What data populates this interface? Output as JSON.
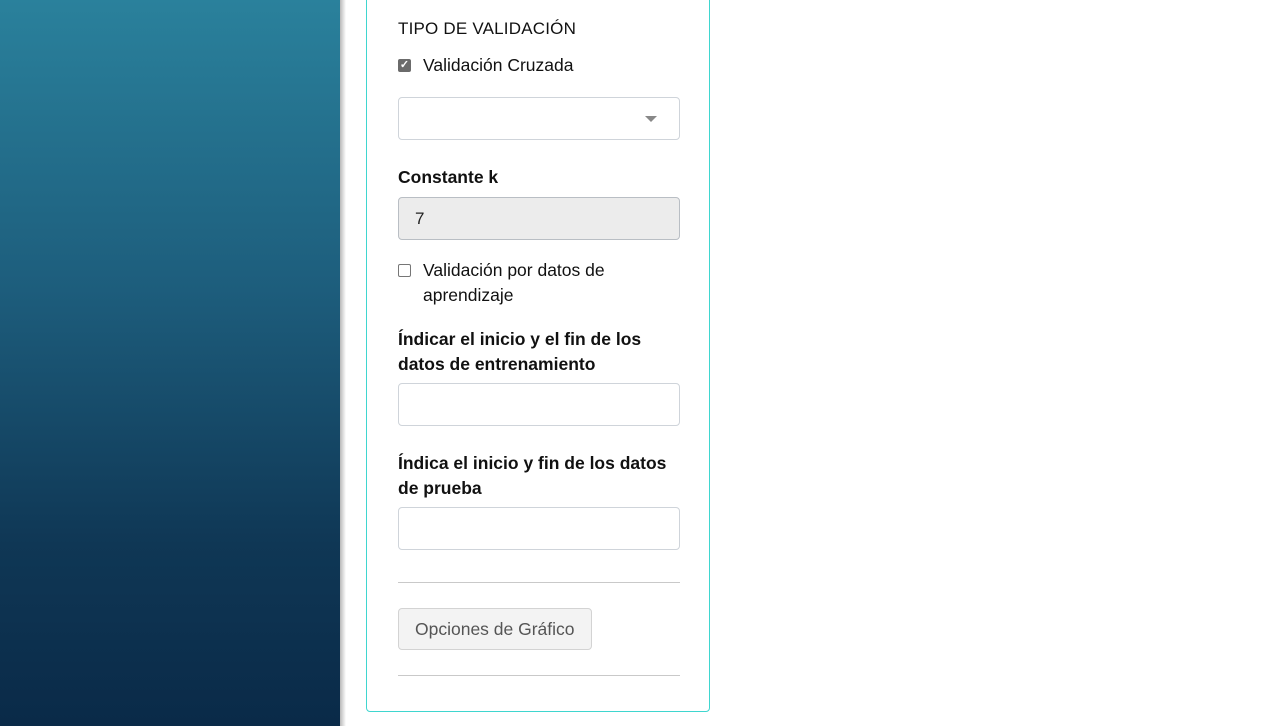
{
  "validation": {
    "section_title": "TIPO DE VALIDACIÓN",
    "cross_validation": {
      "label": "Validación Cruzada",
      "checked": true
    },
    "method_select": {
      "value": ""
    },
    "k_constant": {
      "label": "Constante k",
      "value": "7"
    },
    "learning_validation": {
      "label": "Validación por datos de aprendizaje",
      "checked": false
    },
    "training_range": {
      "label": "Índicar el inicio y el fin de los datos de entrenamiento",
      "value": ""
    },
    "test_range": {
      "label": "Índica el inicio y fin de los datos de prueba",
      "value": ""
    }
  },
  "chart_options_button": {
    "label": "Opciones de Gráfico"
  },
  "colors": {
    "panel_border": "#3fd6cf",
    "sidebar_top": "#2a819c",
    "sidebar_bottom": "#0a2a48"
  }
}
